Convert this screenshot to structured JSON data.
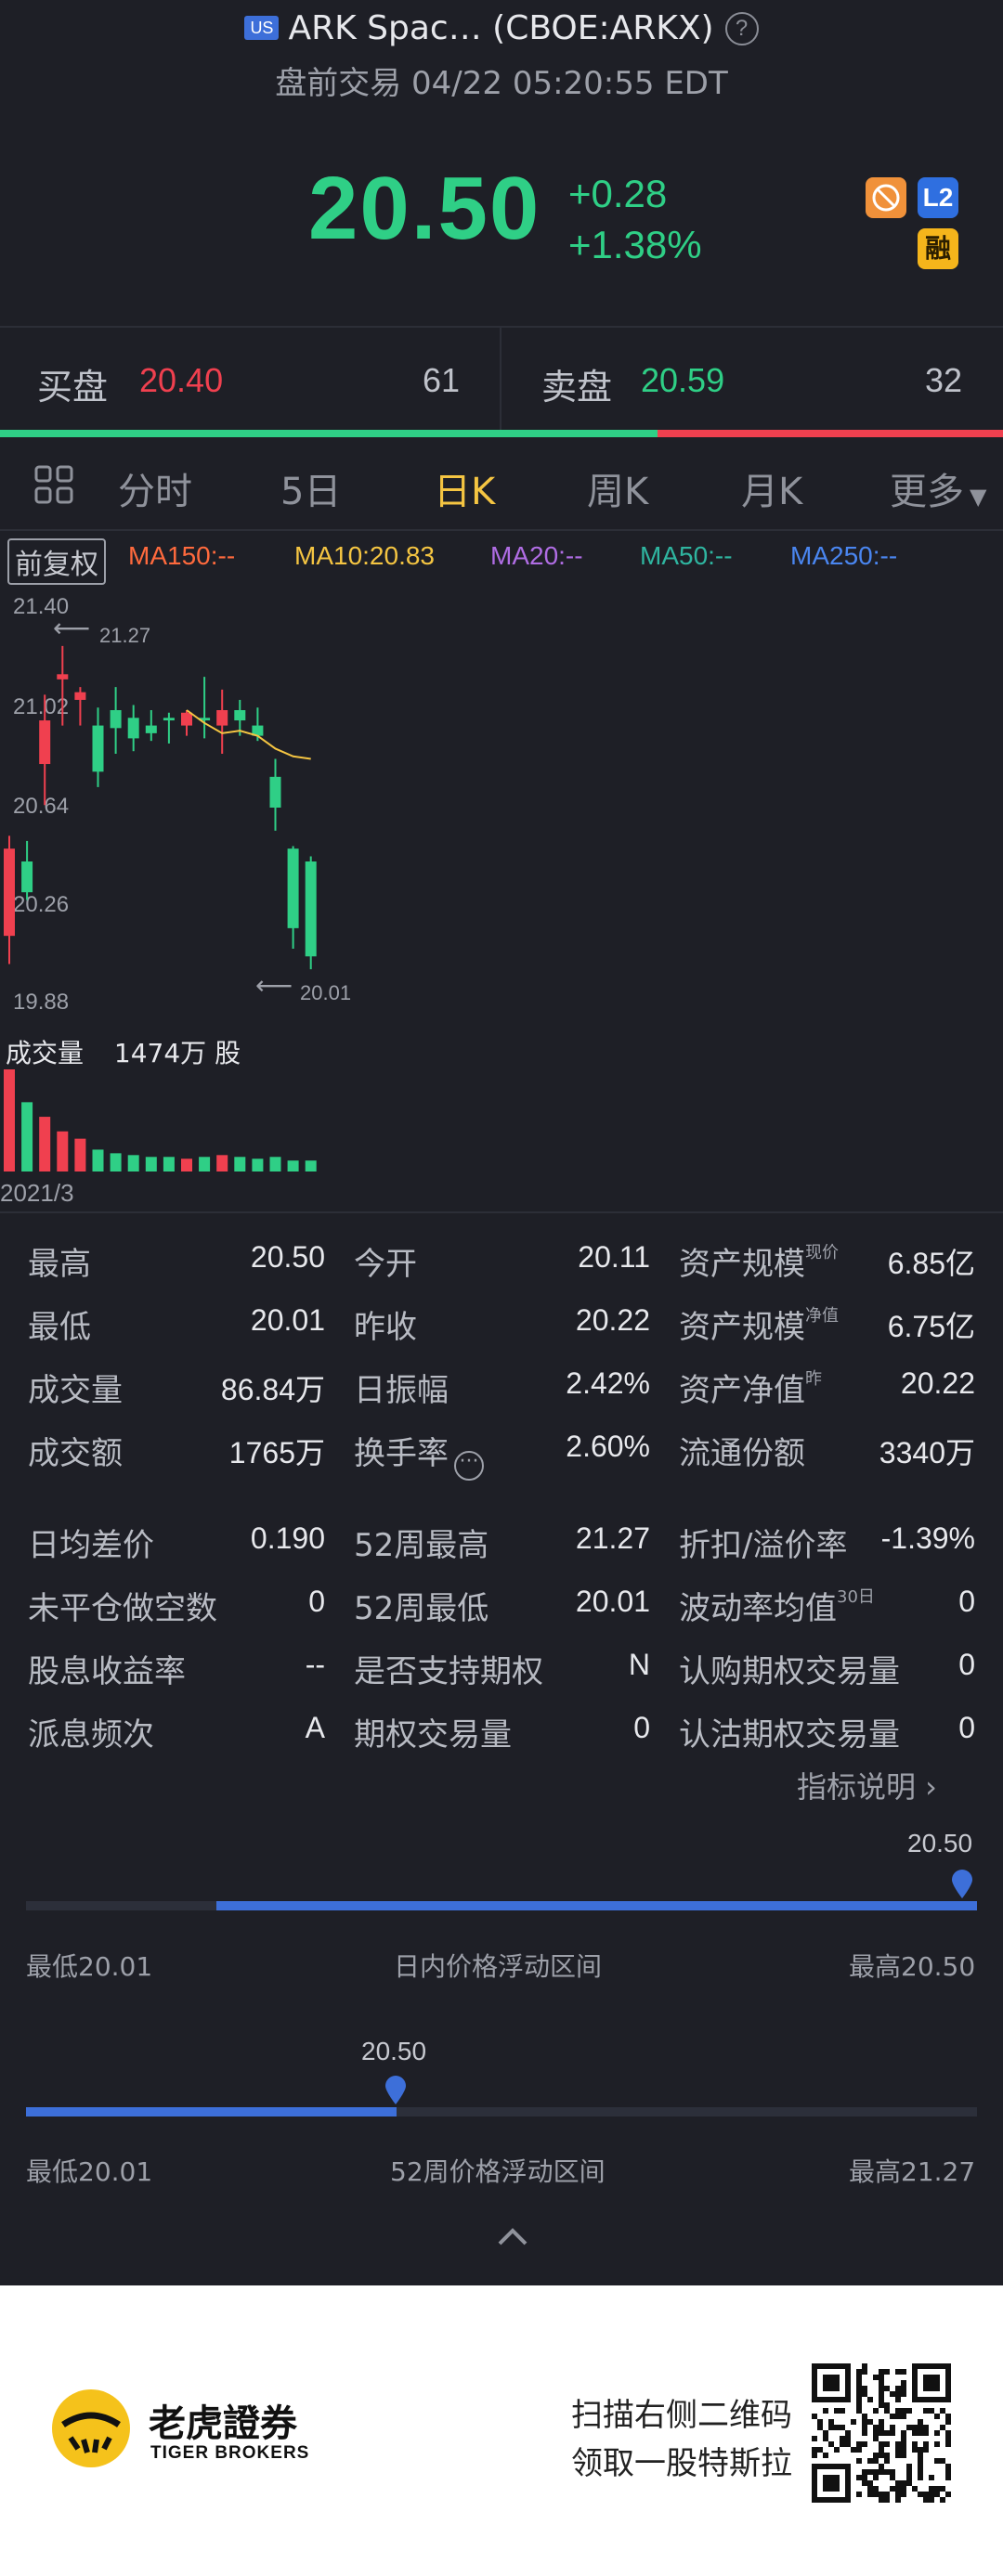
{
  "header": {
    "market_badge": "US",
    "title": "ARK Spac… (CBOE:ARKX)",
    "help": "?",
    "subtitle": "盘前交易 04/22 05:20:55 EDT"
  },
  "quote": {
    "price": "20.50",
    "change": "+0.28",
    "change_pct": "+1.38%",
    "badges": [
      "L2",
      "融"
    ]
  },
  "order_book": {
    "bid_label": "买盘",
    "bid_price": "20.40",
    "bid_size": "61",
    "ask_label": "卖盘",
    "ask_price": "20.59",
    "ask_size": "32"
  },
  "tabs": [
    "分时",
    "5日",
    "日K",
    "周K",
    "月K",
    "更多"
  ],
  "active_tab": "日K",
  "ma": {
    "adjust": "前复权",
    "ma150": "MA150:--",
    "ma10": "MA10:20.83",
    "ma20": "MA20:--",
    "ma50": "MA50:--",
    "ma250": "MA250:--"
  },
  "colors": {
    "up": "#f0404f",
    "down": "#2fcf86",
    "accent": "#f5c542",
    "range": "#3d6fd9"
  },
  "chart_data": {
    "type": "candlestick",
    "y_ticks": [
      "21.40",
      "21.02",
      "20.64",
      "20.26",
      "19.88"
    ],
    "high_marker": "21.27",
    "low_marker": "20.01",
    "volume_label": "成交量",
    "volume_value": "1474万 股",
    "x_label": "2021/3",
    "candles": [
      {
        "o": 20.14,
        "h": 20.53,
        "l": 20.03,
        "c": 20.48
      },
      {
        "o": 20.43,
        "h": 20.51,
        "l": 20.28,
        "c": 20.31
      },
      {
        "o": 20.81,
        "h": 21.08,
        "l": 20.65,
        "c": 20.98
      },
      {
        "o": 21.14,
        "h": 21.27,
        "l": 20.96,
        "c": 21.16
      },
      {
        "o": 21.06,
        "h": 21.11,
        "l": 20.96,
        "c": 21.09
      },
      {
        "o": 20.96,
        "h": 21.03,
        "l": 20.72,
        "c": 20.78
      },
      {
        "o": 21.02,
        "h": 21.11,
        "l": 20.85,
        "c": 20.95
      },
      {
        "o": 20.99,
        "h": 21.04,
        "l": 20.86,
        "c": 20.91
      },
      {
        "o": 20.96,
        "h": 21.02,
        "l": 20.9,
        "c": 20.93
      },
      {
        "o": 20.99,
        "h": 21.01,
        "l": 20.89,
        "c": 20.98
      },
      {
        "o": 20.96,
        "h": 21.02,
        "l": 20.92,
        "c": 21.01
      },
      {
        "o": 20.99,
        "h": 21.15,
        "l": 20.91,
        "c": 20.98
      },
      {
        "o": 20.96,
        "h": 21.1,
        "l": 20.85,
        "c": 21.02
      },
      {
        "o": 21.02,
        "h": 21.06,
        "l": 20.92,
        "c": 20.98
      },
      {
        "o": 20.96,
        "h": 21.03,
        "l": 20.9,
        "c": 20.92
      },
      {
        "o": 20.76,
        "h": 20.83,
        "l": 20.55,
        "c": 20.64
      },
      {
        "o": 20.48,
        "h": 20.49,
        "l": 20.09,
        "c": 20.17
      },
      {
        "o": 20.43,
        "h": 20.45,
        "l": 20.01,
        "c": 20.06
      }
    ],
    "ma10": [
      21.02,
      20.97,
      20.93,
      20.94,
      20.92,
      20.87,
      20.84,
      20.83
    ],
    "volumes": [
      2.8,
      1.9,
      1.5,
      1.1,
      0.9,
      0.6,
      0.5,
      0.45,
      0.4,
      0.4,
      0.35,
      0.4,
      0.45,
      0.4,
      0.35,
      0.4,
      0.3,
      0.3
    ]
  },
  "stats": [
    [
      {
        "label": "最高",
        "value": "20.50"
      },
      {
        "label": "今开",
        "value": "20.11"
      },
      {
        "label": "资产规模",
        "sup": "现价",
        "value": "6.85亿"
      }
    ],
    [
      {
        "label": "最低",
        "value": "20.01"
      },
      {
        "label": "昨收",
        "value": "20.22"
      },
      {
        "label": "资产规模",
        "sup": "净值",
        "value": "6.75亿"
      }
    ],
    [
      {
        "label": "成交量",
        "value": "86.84万"
      },
      {
        "label": "日振幅",
        "value": "2.42%"
      },
      {
        "label": "资产净值",
        "sup": "昨",
        "value": "20.22"
      }
    ],
    [
      {
        "label": "成交额",
        "value": "1765万"
      },
      {
        "label": "换手率",
        "icon": "more-dots-icon",
        "value": "2.60%"
      },
      {
        "label": "流通份额",
        "value": "3340万"
      }
    ],
    [
      {
        "label": "日均差价",
        "value": "0.190"
      },
      {
        "label": "52周最高",
        "value": "21.27"
      },
      {
        "label": "折扣/溢价率",
        "value": "-1.39%"
      }
    ],
    [
      {
        "label": "未平仓做空数",
        "value": "0"
      },
      {
        "label": "52周最低",
        "value": "20.01"
      },
      {
        "label": "波动率均值",
        "sup": "30日",
        "value": "0"
      }
    ],
    [
      {
        "label": "股息收益率",
        "value": "--"
      },
      {
        "label": "是否支持期权",
        "value": "N"
      },
      {
        "label": "认购期权交易量",
        "value": "0"
      }
    ],
    [
      {
        "label": "派息频次",
        "value": "A"
      },
      {
        "label": "期权交易量",
        "value": "0"
      },
      {
        "label": "认沽期权交易量",
        "value": "0"
      }
    ]
  ],
  "indicator_link": "指标说明 ›",
  "day_range": {
    "current": "20.50",
    "fill_fraction": 1.0,
    "low_label": "最低20.01",
    "title": "日内价格浮动区间",
    "high_label": "最高20.50"
  },
  "week52_range": {
    "current": "20.50",
    "fill_fraction": 0.39,
    "low_label": "最低20.01",
    "title": "52周价格浮动区间",
    "high_label": "最高21.27"
  },
  "footer": {
    "brand_cn": "老虎證券",
    "brand_en": "TIGER BROKERS",
    "promo_line1": "扫描右侧二维码",
    "promo_line2": "领取一股特斯拉"
  }
}
